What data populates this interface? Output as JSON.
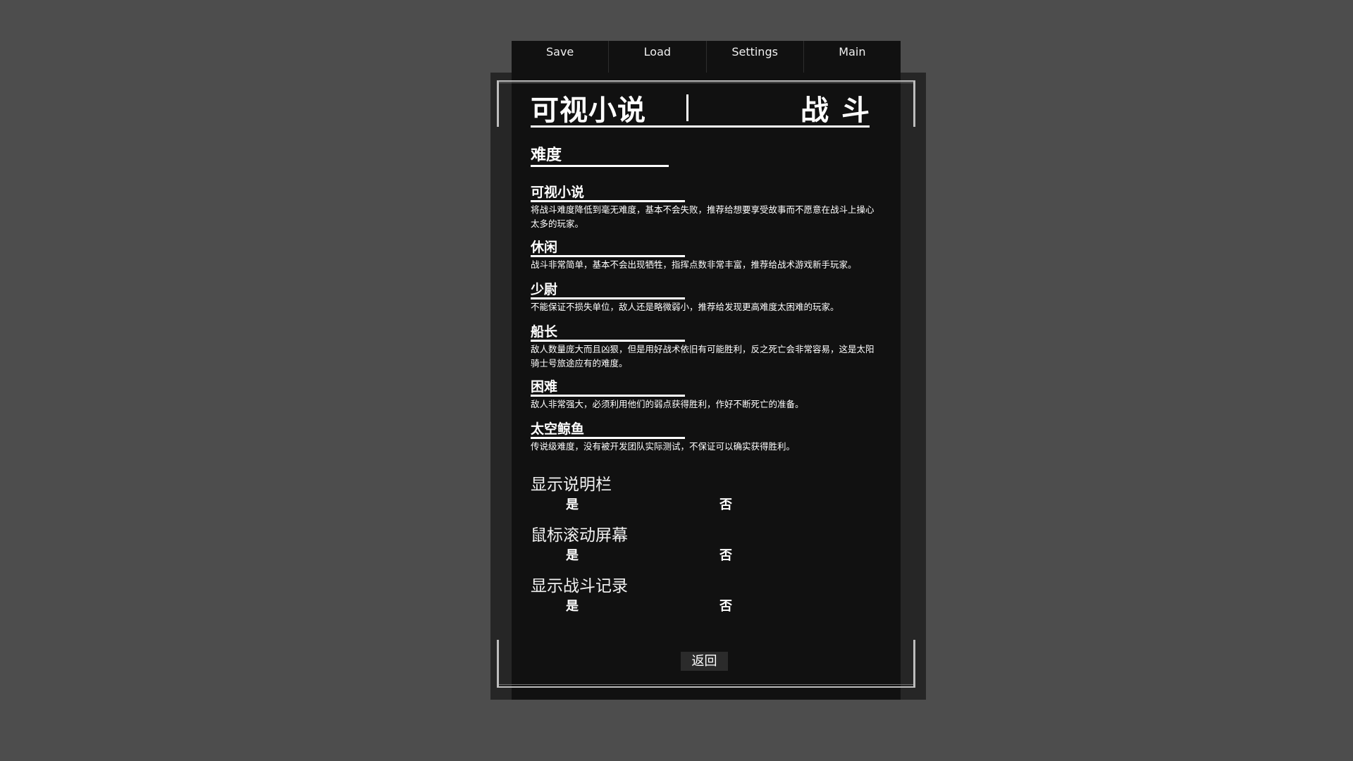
{
  "top_menu": {
    "tabs": [
      "Save",
      "Load",
      "Settings",
      "Main"
    ]
  },
  "header": {
    "title_left": "可视小说",
    "title_right": "战斗"
  },
  "difficulty": {
    "heading": "难度",
    "levels": [
      {
        "name": "可视小说",
        "description": "将战斗难度降低到毫无难度，基本不会失败，推荐给想要享受故事而不愿意在战斗上操心太多的玩家。"
      },
      {
        "name": "休闲",
        "description": "战斗非常简单，基本不会出现牺牲，指挥点数非常丰富，推荐给战术游戏新手玩家。"
      },
      {
        "name": "少尉",
        "description": "不能保证不损失单位，敌人还是略微弱小，推荐给发现更高难度太困难的玩家。"
      },
      {
        "name": "船长",
        "description": "敌人数量庞大而且凶狠，但是用好战术依旧有可能胜利，反之死亡会非常容易，这是太阳骑士号旅途应有的难度。"
      },
      {
        "name": "困难",
        "description": "敌人非常强大，必须利用他们的弱点获得胜利，作好不断死亡的准备。"
      },
      {
        "name": "太空鲸鱼",
        "description": "传说级难度，没有被开发团队实际测试，不保证可以确实获得胜利。"
      }
    ]
  },
  "options": [
    {
      "label": "显示说明栏",
      "yes": "是",
      "no": "否"
    },
    {
      "label": "鼠标滚动屏幕",
      "yes": "是",
      "no": "否"
    },
    {
      "label": "显示战斗记录",
      "yes": "是",
      "no": "否"
    }
  ],
  "footer": {
    "back_label": "返回"
  }
}
